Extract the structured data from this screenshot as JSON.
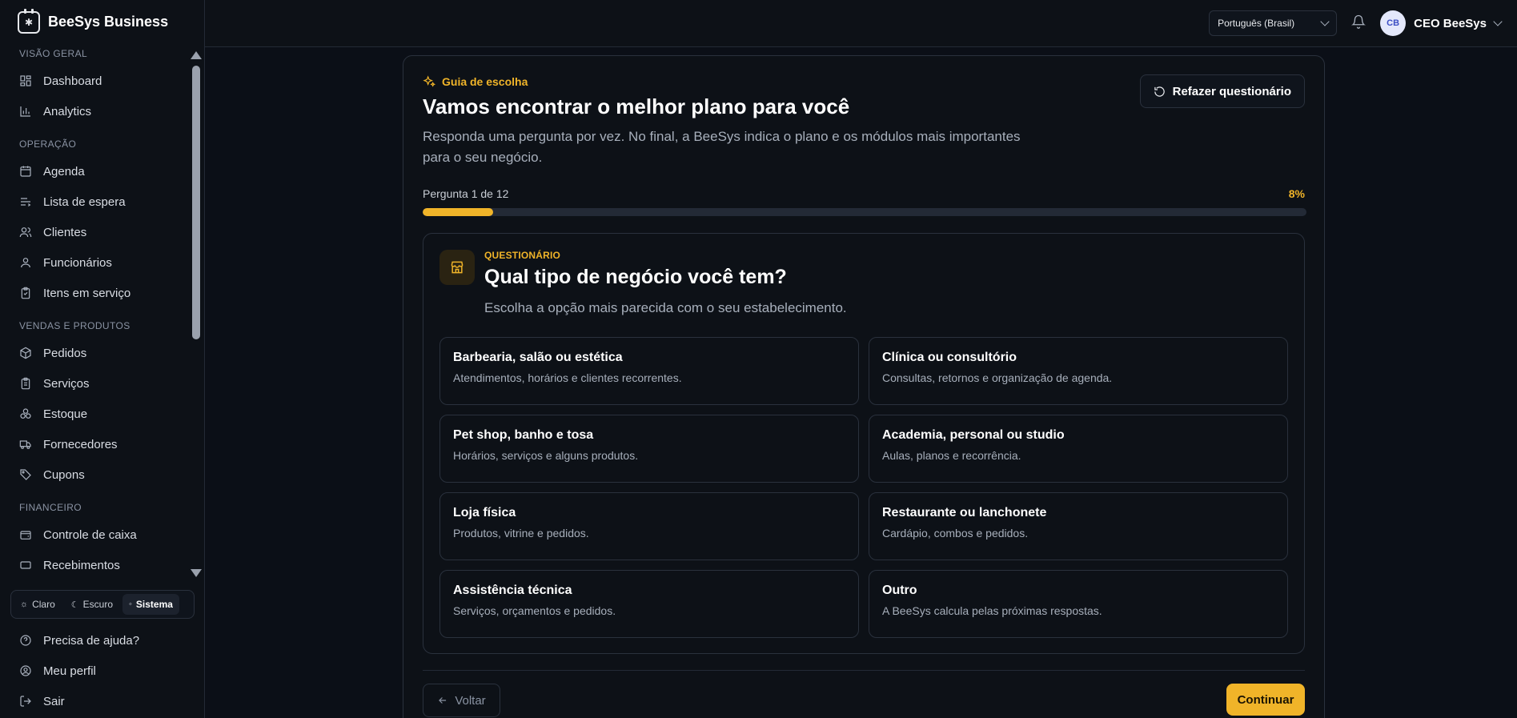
{
  "app": {
    "brand": "BeeSys Business",
    "logo_glyph": "⌘"
  },
  "sidebar": {
    "sections": [
      {
        "label": "VISÃO GERAL",
        "items": [
          {
            "label": "Dashboard",
            "icon": "dashboard-icon"
          },
          {
            "label": "Analytics",
            "icon": "bar-chart-icon"
          }
        ]
      },
      {
        "label": "OPERAÇÃO",
        "items": [
          {
            "label": "Agenda",
            "icon": "calendar-icon"
          },
          {
            "label": "Lista de espera",
            "icon": "list-icon"
          },
          {
            "label": "Clientes",
            "icon": "users-icon"
          },
          {
            "label": "Funcionários",
            "icon": "user-icon"
          },
          {
            "label": "Itens em serviço",
            "icon": "clipboard-icon"
          }
        ]
      },
      {
        "label": "VENDAS E PRODUTOS",
        "items": [
          {
            "label": "Pedidos",
            "icon": "package-icon"
          },
          {
            "label": "Serviços",
            "icon": "clipboard-list-icon"
          },
          {
            "label": "Estoque",
            "icon": "boxes-icon"
          },
          {
            "label": "Fornecedores",
            "icon": "truck-icon"
          },
          {
            "label": "Cupons",
            "icon": "tag-icon"
          }
        ]
      },
      {
        "label": "FINANCEIRO",
        "items": [
          {
            "label": "Controle de caixa",
            "icon": "wallet-icon"
          },
          {
            "label": "Recebimentos",
            "icon": "receipt-icon"
          }
        ]
      }
    ],
    "theme": {
      "options": [
        "Claro",
        "Escuro",
        "Sistema"
      ],
      "selected": "Sistema"
    },
    "bottom": [
      {
        "label": "Precisa de ajuda?",
        "icon": "help-icon"
      },
      {
        "label": "Meu perfil",
        "icon": "profile-icon"
      },
      {
        "label": "Sair",
        "icon": "logout-icon"
      }
    ]
  },
  "topbar": {
    "language": "Português (Brasil)",
    "user": {
      "initials": "CB",
      "name": "CEO BeeSys"
    }
  },
  "guide": {
    "tag": "Guia de escolha",
    "title": "Vamos encontrar o melhor plano para você",
    "subtitle": "Responda uma pergunta por vez. No final, a BeeSys indica o plano e os módulos mais importantes para o seu negócio.",
    "redo_label": "Refazer questionário",
    "progress": {
      "label": "Pergunta 1 de 12",
      "percent_label": "8%",
      "value": 0.08
    }
  },
  "question": {
    "kicker": "QUESTIONÁRIO",
    "title": "Qual tipo de negócio você tem?",
    "description": "Escolha a opção mais parecida com o seu estabelecimento.",
    "options": [
      {
        "title": "Barbearia, salão ou estética",
        "desc": "Atendimentos, horários e clientes recorrentes."
      },
      {
        "title": "Clínica ou consultório",
        "desc": "Consultas, retornos e organização de agenda."
      },
      {
        "title": "Pet shop, banho e tosa",
        "desc": "Horários, serviços e alguns produtos."
      },
      {
        "title": "Academia, personal ou studio",
        "desc": "Aulas, planos e recorrência."
      },
      {
        "title": "Loja física",
        "desc": "Produtos, vitrine e pedidos."
      },
      {
        "title": "Restaurante ou lanchonete",
        "desc": "Cardápio, combos e pedidos."
      },
      {
        "title": "Assistência técnica",
        "desc": "Serviços, orçamentos e pedidos."
      },
      {
        "title": "Outro",
        "desc": "A BeeSys calcula pelas próximas respostas."
      }
    ]
  },
  "footer": {
    "back_label": "Voltar",
    "continue_label": "Continuar"
  },
  "colors": {
    "accent": "#f0b429",
    "background": "#0b0f17",
    "panel": "#0d1117",
    "border": "#2a313d"
  }
}
